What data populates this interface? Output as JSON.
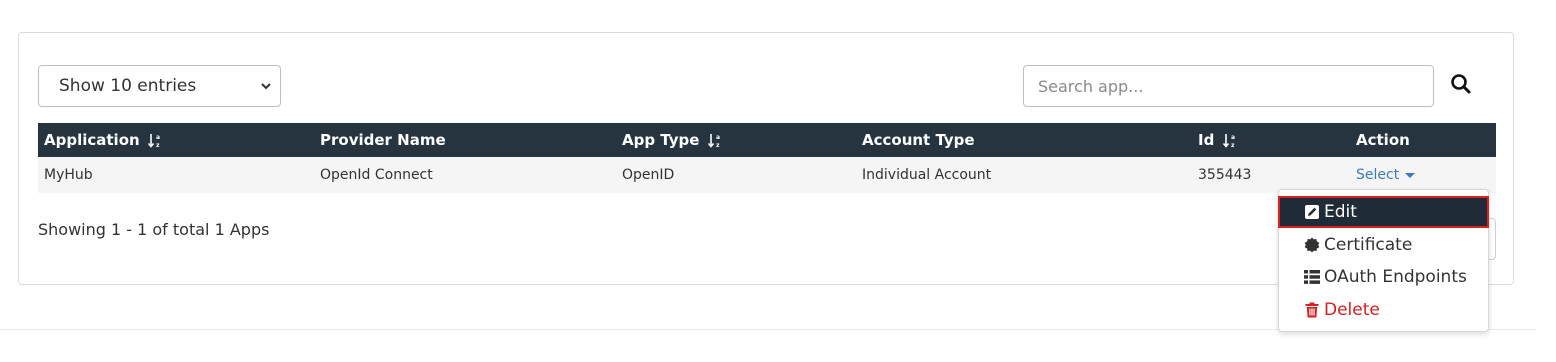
{
  "controls": {
    "entries_select": "Show 10 entries",
    "search_placeholder": "Search app..."
  },
  "table": {
    "columns": [
      "Application",
      "Provider Name",
      "App Type",
      "Account Type",
      "Id",
      "Action"
    ],
    "rows": [
      {
        "application": "MyHub",
        "provider": "OpenId Connect",
        "app_type": "OpenID",
        "account_type": "Individual Account",
        "id": "355443",
        "action": "Select"
      }
    ]
  },
  "footer": {
    "showing": "Showing 1 - 1 of total 1 Apps"
  },
  "dropdown": {
    "items": [
      {
        "label": "Edit",
        "icon": "edit-icon"
      },
      {
        "label": "Certificate",
        "icon": "certificate-icon"
      },
      {
        "label": "OAuth Endpoints",
        "icon": "list-icon"
      },
      {
        "label": "Delete",
        "icon": "trash-icon"
      }
    ]
  },
  "colors": {
    "header_bg": "#263440",
    "link": "#3b7ac2",
    "danger": "#d42020",
    "highlight_border": "#e02020"
  }
}
